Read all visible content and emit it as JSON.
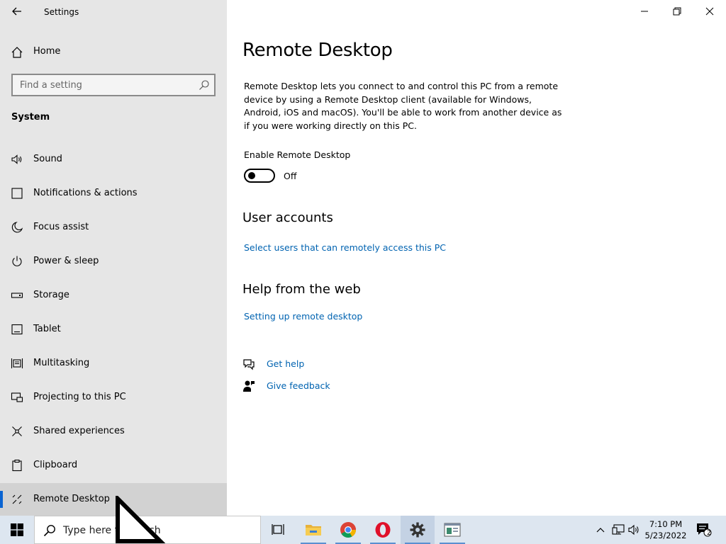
{
  "window": {
    "title": "Settings",
    "back_label": "Back",
    "minimize_label": "Minimize",
    "restore_label": "Restore",
    "close_label": "Close"
  },
  "sidebar": {
    "home_label": "Home",
    "search_placeholder": "Find a setting",
    "section_title": "System",
    "items": [
      {
        "label": "Sound",
        "icon": "speaker-icon"
      },
      {
        "label": "Notifications & actions",
        "icon": "notification-icon"
      },
      {
        "label": "Focus assist",
        "icon": "moon-icon"
      },
      {
        "label": "Power & sleep",
        "icon": "power-icon"
      },
      {
        "label": "Storage",
        "icon": "storage-icon"
      },
      {
        "label": "Tablet",
        "icon": "tablet-icon"
      },
      {
        "label": "Multitasking",
        "icon": "multitasking-icon"
      },
      {
        "label": "Projecting to this PC",
        "icon": "projector-icon"
      },
      {
        "label": "Shared experiences",
        "icon": "shared-experiences-icon"
      },
      {
        "label": "Clipboard",
        "icon": "clipboard-icon"
      },
      {
        "label": "Remote Desktop",
        "icon": "remote-desktop-icon",
        "selected": true
      }
    ]
  },
  "main": {
    "title": "Remote Desktop",
    "description": "Remote Desktop lets you connect to and control this PC from a remote device by using a Remote Desktop client (available for Windows, Android, iOS and macOS). You'll be able to work from another device as if you were working directly on this PC.",
    "toggle_label": "Enable Remote Desktop",
    "toggle_state": "Off",
    "toggle_on": false,
    "user_accounts_heading": "User accounts",
    "user_accounts_link": "Select users that can remotely access this PC",
    "help_heading": "Help from the web",
    "help_link": "Setting up remote desktop",
    "get_help": "Get help",
    "give_feedback": "Give feedback"
  },
  "taskbar": {
    "search_placeholder": "Type here to search",
    "apps": [
      {
        "name": "Task View",
        "icon": "task-view-icon"
      },
      {
        "name": "File Explorer",
        "icon": "folder-icon"
      },
      {
        "name": "Google Chrome",
        "icon": "chrome-icon"
      },
      {
        "name": "Opera",
        "icon": "opera-icon"
      },
      {
        "name": "Settings",
        "icon": "gear-icon"
      },
      {
        "name": "Remote app",
        "icon": "app-window-icon"
      }
    ],
    "time": "7:10 PM",
    "date": "5/23/2022",
    "notification_count": "2"
  },
  "colors": {
    "accent": "#0063b1",
    "selection_bar": "#0a64d2",
    "sidebar_bg": "#e6e6e6",
    "taskbar_bg": "#dde6f0"
  }
}
